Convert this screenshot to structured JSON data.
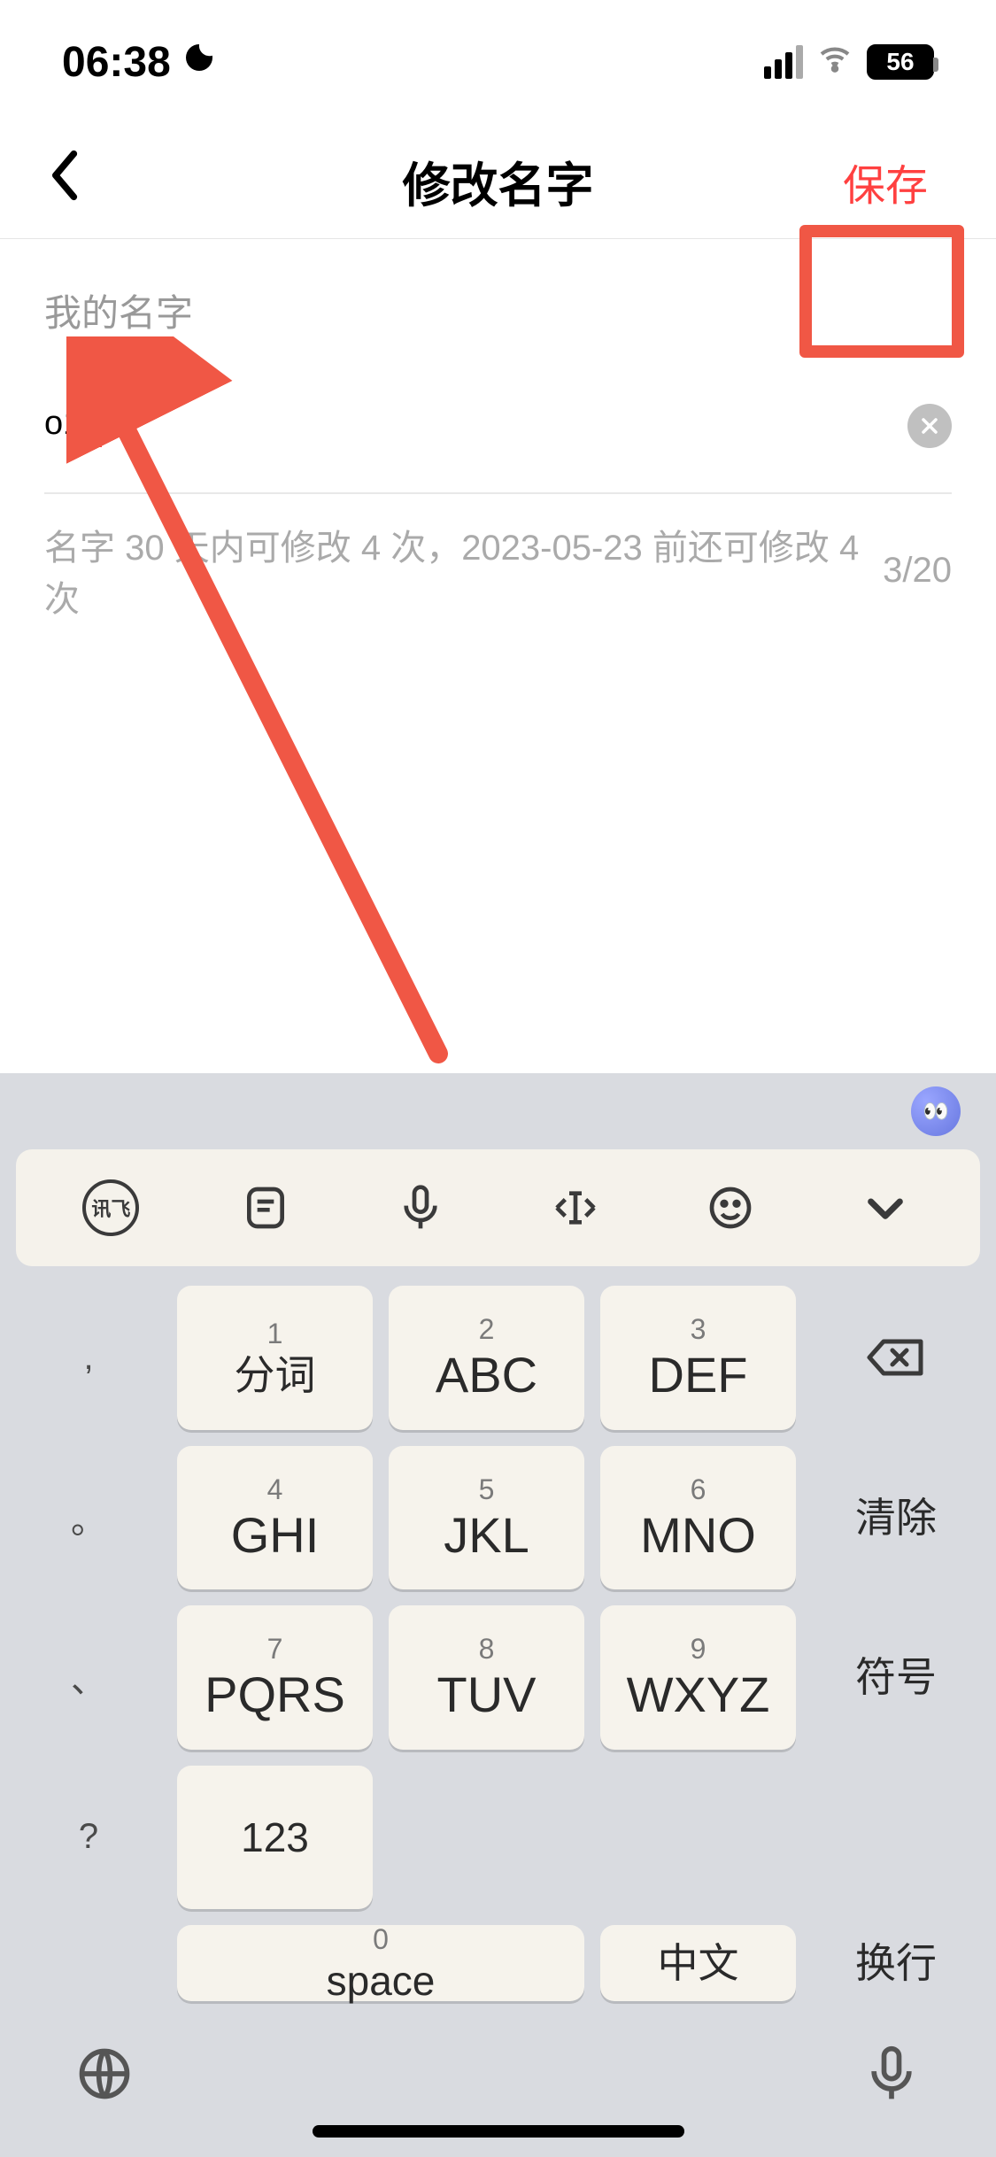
{
  "statusBar": {
    "time": "06:38",
    "battery": "56"
  },
  "nav": {
    "title": "修改名字",
    "save": "保存"
  },
  "form": {
    "label": "我的名字",
    "value": "o12",
    "hint": "名字 30 天内可修改 4 次，2023-05-23 前还可修改 4 次",
    "counter": "3/20"
  },
  "kbToolbar": {
    "brand": "讯飞"
  },
  "keys": {
    "left": [
      ",",
      "。",
      "、",
      ":",
      "?"
    ],
    "grid": [
      {
        "n": "1",
        "m": "分词"
      },
      {
        "n": "2",
        "m": "ABC"
      },
      {
        "n": "3",
        "m": "DEF"
      },
      {
        "n": "4",
        "m": "GHI"
      },
      {
        "n": "5",
        "m": "JKL"
      },
      {
        "n": "6",
        "m": "MNO"
      },
      {
        "n": "7",
        "m": "PQRS"
      },
      {
        "n": "8",
        "m": "TUV"
      },
      {
        "n": "9",
        "m": "WXYZ"
      }
    ],
    "numMode": "123",
    "spaceNum": "0",
    "space": "space",
    "lang": "中文",
    "right": {
      "clear": "清除",
      "symbols": "符号",
      "enter": "换行"
    }
  }
}
